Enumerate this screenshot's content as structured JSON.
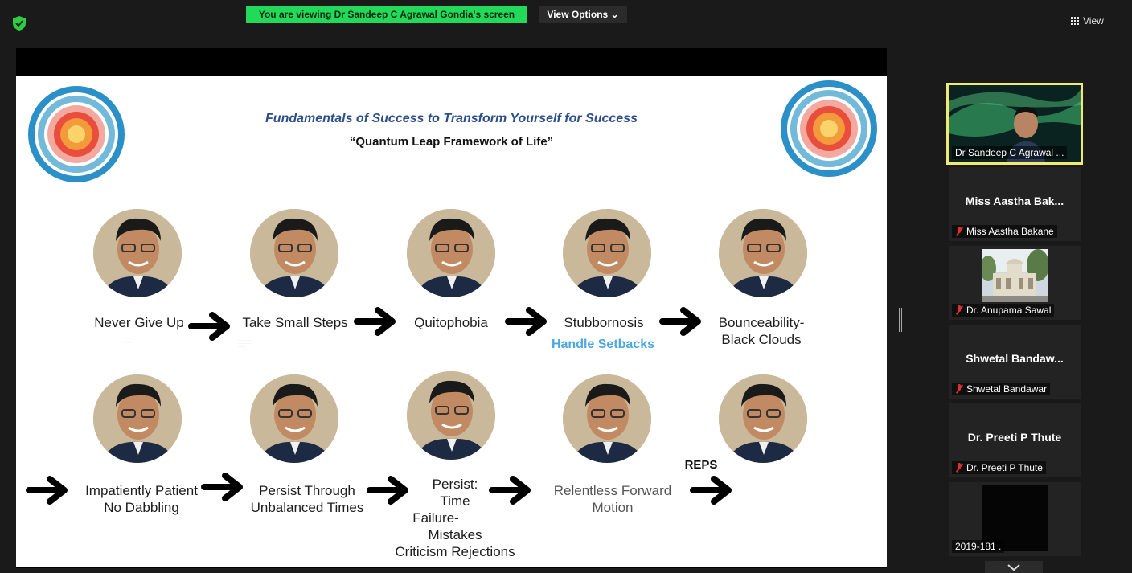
{
  "top_bar": {
    "viewing_banner": "You are viewing Dr Sandeep C Agrawal Gondia's screen",
    "view_options_label": "View Options ⌄",
    "view_button_label": "View"
  },
  "slide": {
    "title": "Fundamentals of Success to Transform Yourself for Success",
    "subtitle": "“Quantum Leap Framework of Life”",
    "row1": [
      {
        "label": "Never Give Up"
      },
      {
        "label": "Take Small Steps"
      },
      {
        "label": "Quitophobia"
      },
      {
        "label": "Stubbornosis",
        "sub": "Handle Setbacks"
      },
      {
        "label": "Bounceability-",
        "label2": "Black Clouds"
      }
    ],
    "row2": [
      {
        "label": "Impatiently Patient",
        "label2": "No Dabbling"
      },
      {
        "label": "Persist Through",
        "label2": "Unbalanced Times"
      },
      {
        "lines": [
          "Persist:",
          "Time",
          "Failure-",
          "Mistakes",
          "Criticism Rejections"
        ]
      },
      {
        "label": "Relentless Forward",
        "label2": "Motion"
      },
      {
        "label": "REPS"
      }
    ]
  },
  "participants": [
    {
      "caption": "Dr Sandeep C Agrawal ...",
      "active": true
    },
    {
      "name": "Miss Aastha Bak...",
      "caption": "Miss Aastha Bakane",
      "muted": true
    },
    {
      "caption": "Dr. Anupama Sawal",
      "muted": true
    },
    {
      "name": "Shwetal  Bandaw...",
      "caption": "Shwetal Bandawar",
      "muted": true
    },
    {
      "name": "Dr. Preeti P Thute",
      "caption": "Dr. Preeti P Thute",
      "muted": true
    },
    {
      "caption": "2019-181 ."
    }
  ],
  "colors": {
    "banner_green": "#23d959",
    "active_tile_outline": "#f0ea72",
    "slide_title_blue": "#2c4f8c",
    "handle_setbacks_blue": "#4aa8e0",
    "mute_red": "#e03030"
  },
  "icons": [
    "shield-check-icon",
    "grid-view-icon",
    "mic-muted-icon",
    "arrow-right-icon",
    "target-icon",
    "chevron-down-icon"
  ]
}
